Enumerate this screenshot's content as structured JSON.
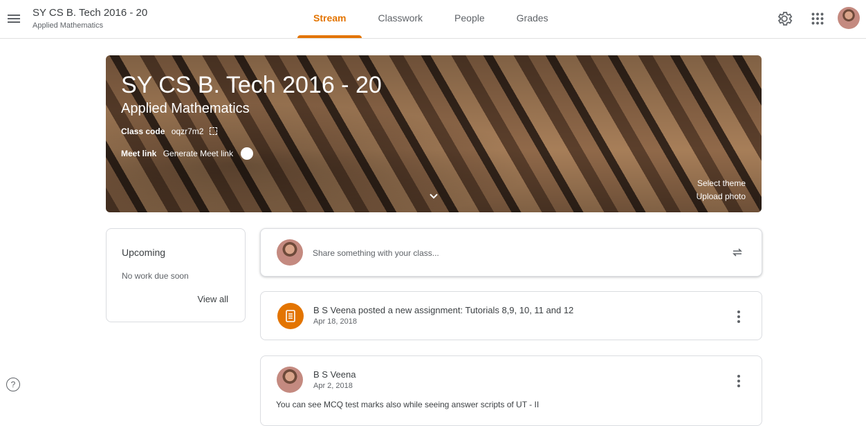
{
  "header": {
    "class_title": "SY CS B. Tech 2016 - 20",
    "class_subtitle": "Applied Mathematics",
    "tabs": [
      {
        "label": "Stream",
        "active": true
      },
      {
        "label": "Classwork",
        "active": false
      },
      {
        "label": "People",
        "active": false
      },
      {
        "label": "Grades",
        "active": false
      }
    ],
    "icons": [
      "menu-icon",
      "settings-icon",
      "apps-grid-icon",
      "user-avatar"
    ]
  },
  "banner": {
    "title": "SY CS B. Tech 2016 - 20",
    "subtitle": "Applied Mathematics",
    "class_code_label": "Class code",
    "class_code": "oqzr7m2",
    "meet_label": "Meet link",
    "meet_value": "Generate Meet link",
    "select_theme": "Select theme",
    "upload_photo": "Upload photo"
  },
  "upcoming": {
    "title": "Upcoming",
    "text": "No work due soon",
    "link": "View all"
  },
  "share": {
    "placeholder": "Share something with your class..."
  },
  "posts": [
    {
      "type": "assignment",
      "title": "B S Veena posted a new assignment: Tutorials 8,9, 10, 11 and 12",
      "date": "Apr 18, 2018"
    },
    {
      "type": "announcement",
      "author": "B S Veena",
      "date": "Apr 2, 2018",
      "body": "You can see MCQ test marks also while seeing answer scripts of UT - II"
    }
  ],
  "colors": {
    "accent": "#e37400",
    "text": "#3c4043",
    "secondary": "#5f6368",
    "border": "#dadce0"
  }
}
